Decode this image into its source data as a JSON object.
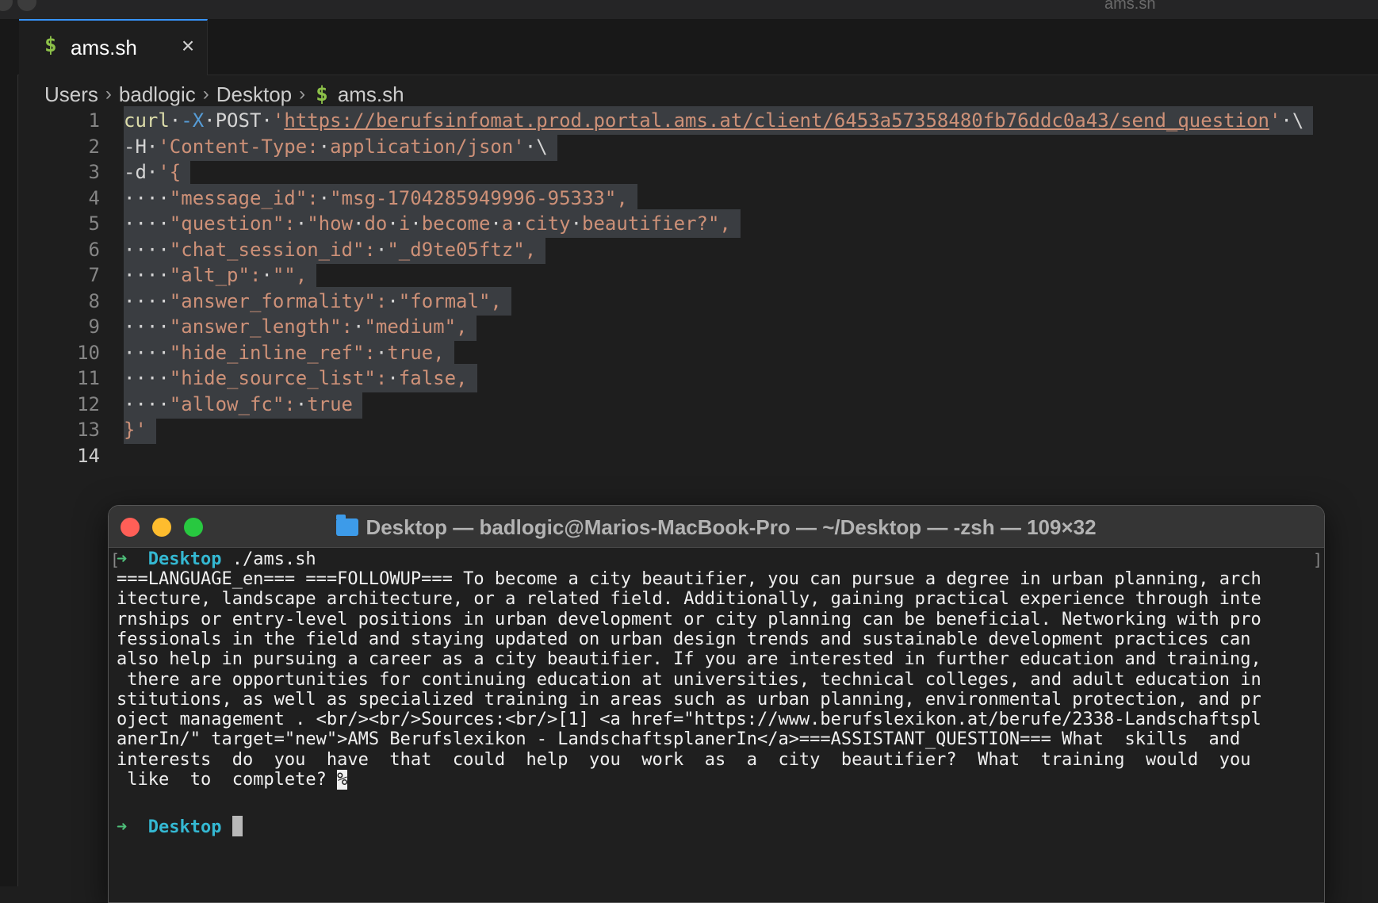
{
  "window": {
    "title": "ams.sh"
  },
  "tab": {
    "icon": "$",
    "label": "ams.sh",
    "close_icon": "×"
  },
  "breadcrumb": {
    "items": [
      "Users",
      "badlogic",
      "Desktop"
    ],
    "separator": "›",
    "file_icon": "$",
    "file": "ams.sh"
  },
  "editor": {
    "line_numbers": [
      "1",
      "2",
      "3",
      "4",
      "5",
      "6",
      "7",
      "8",
      "9",
      "10",
      "11",
      "12",
      "13",
      "14"
    ],
    "lines": [
      [
        [
          "cmd",
          "curl"
        ],
        [
          "ws",
          "·"
        ],
        [
          "flag",
          "-X"
        ],
        [
          "ws",
          "·"
        ],
        [
          "plain",
          "POST"
        ],
        [
          "ws",
          "·"
        ],
        [
          "str",
          "'"
        ],
        [
          "url",
          "https://berufsinfomat.prod.portal.ams.at/client/6453a57358480fb76ddc0a43/send_question"
        ],
        [
          "str",
          "'"
        ],
        [
          "ws",
          "·"
        ],
        [
          "plain",
          "\\"
        ]
      ],
      [
        [
          "plain",
          "-H"
        ],
        [
          "ws",
          "·"
        ],
        [
          "str",
          "'Content-Type:"
        ],
        [
          "ws",
          "·"
        ],
        [
          "str",
          "application/json'"
        ],
        [
          "ws",
          "·"
        ],
        [
          "plain",
          "\\"
        ]
      ],
      [
        [
          "plain",
          "-d"
        ],
        [
          "ws",
          "·"
        ],
        [
          "str",
          "'{"
        ]
      ],
      [
        [
          "ws",
          "····"
        ],
        [
          "str",
          "\"message_id\":"
        ],
        [
          "ws",
          "·"
        ],
        [
          "str",
          "\"msg-1704285949996-95333\","
        ]
      ],
      [
        [
          "ws",
          "····"
        ],
        [
          "str",
          "\"question\":"
        ],
        [
          "ws",
          "·"
        ],
        [
          "str",
          "\"how"
        ],
        [
          "ws",
          "·"
        ],
        [
          "str",
          "do"
        ],
        [
          "ws",
          "·"
        ],
        [
          "str",
          "i"
        ],
        [
          "ws",
          "·"
        ],
        [
          "str",
          "become"
        ],
        [
          "ws",
          "·"
        ],
        [
          "str",
          "a"
        ],
        [
          "ws",
          "·"
        ],
        [
          "str",
          "city"
        ],
        [
          "ws",
          "·"
        ],
        [
          "str",
          "beautifier?\","
        ]
      ],
      [
        [
          "ws",
          "····"
        ],
        [
          "str",
          "\"chat_session_id\":"
        ],
        [
          "ws",
          "·"
        ],
        [
          "str",
          "\"_d9te05ftz\","
        ]
      ],
      [
        [
          "ws",
          "····"
        ],
        [
          "str",
          "\"alt_p\":"
        ],
        [
          "ws",
          "·"
        ],
        [
          "str",
          "\"\","
        ]
      ],
      [
        [
          "ws",
          "····"
        ],
        [
          "str",
          "\"answer_formality\":"
        ],
        [
          "ws",
          "·"
        ],
        [
          "str",
          "\"formal\","
        ]
      ],
      [
        [
          "ws",
          "····"
        ],
        [
          "str",
          "\"answer_length\":"
        ],
        [
          "ws",
          "·"
        ],
        [
          "str",
          "\"medium\","
        ]
      ],
      [
        [
          "ws",
          "····"
        ],
        [
          "str",
          "\"hide_inline_ref\":"
        ],
        [
          "ws",
          "·"
        ],
        [
          "str",
          "true,"
        ]
      ],
      [
        [
          "ws",
          "····"
        ],
        [
          "str",
          "\"hide_source_list\":"
        ],
        [
          "ws",
          "·"
        ],
        [
          "str",
          "false,"
        ]
      ],
      [
        [
          "ws",
          "····"
        ],
        [
          "str",
          "\"allow_fc\":"
        ],
        [
          "ws",
          "·"
        ],
        [
          "str",
          "true"
        ]
      ],
      [
        [
          "str",
          "}'"
        ]
      ],
      []
    ]
  },
  "terminal": {
    "title": "Desktop — badlogic@Marios-MacBook-Pro — ~/Desktop — -zsh — 109×32",
    "prompt_arrow": "➜",
    "prompt_dir": "Desktop",
    "command": "./ams.sh",
    "output_lines": [
      "===LANGUAGE_en=== ===FOLLOWUP=== To become a city beautifier, you can pursue a degree in urban planning, arch",
      "itecture, landscape architecture, or a related field. Additionally, gaining practical experience through inte",
      "rnships or entry-level positions in urban development or city planning can be beneficial. Networking with pro",
      "fessionals in the field and staying updated on urban design trends and sustainable development practices can",
      "also help in pursuing a career as a city beautifier. If you are interested in further education and training,",
      " there are opportunities for continuing education at universities, technical colleges, and adult education in",
      "stitutions, as well as specialized training in areas such as urban planning, environmental protection, and pr",
      "oject management . <br/><br/>Sources:<br/>[1] <a href=\"https://www.berufslexikon.at/berufe/2338-Landschaftspl",
      "anerIn/\" target=\"new\">AMS Berufslexikon - LandschaftsplanerIn</a>===ASSISTANT_QUESTION=== What  skills  and",
      "interests  do  you  have  that  could  help  you  work  as  a  city  beautifier?  What  training  would  you",
      " like  to  complete? "
    ],
    "end_marker": "%"
  }
}
